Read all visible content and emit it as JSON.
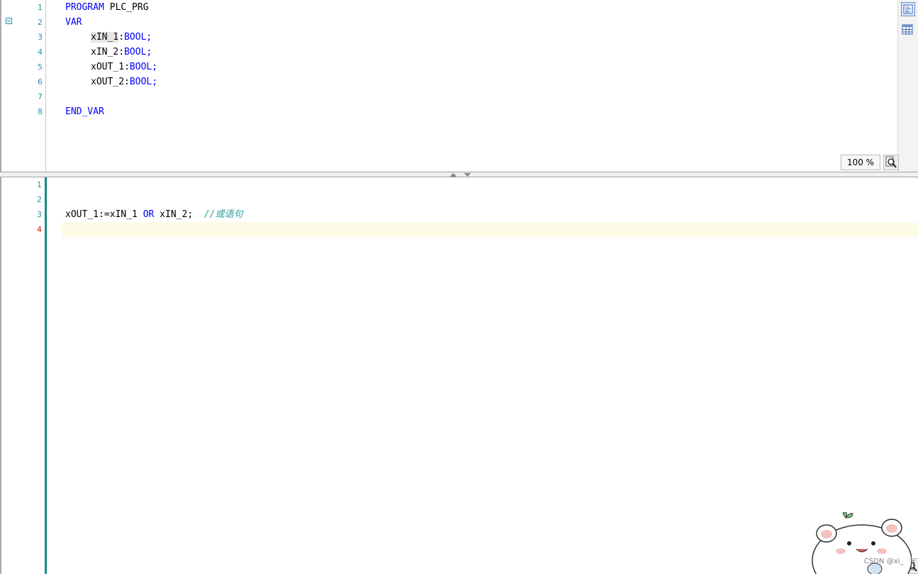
{
  "declaration": {
    "line_numbers": [
      "1",
      "2",
      "3",
      "4",
      "5",
      "6",
      "7",
      "8"
    ],
    "lines": {
      "l1_kw": "PROGRAM",
      "l1_name": " PLC_PRG",
      "l2_kw": "VAR",
      "l3_var": "xIN_1",
      "l3_sep": ":",
      "l3_type": "BOOL;",
      "l4_var": "xIN_2",
      "l4_sep": ":",
      "l4_type": "BOOL;",
      "l5_var": "xOUT_1",
      "l5_sep": ":",
      "l5_type": "BOOL;",
      "l6_var": "xOUT_2",
      "l6_sep": ":",
      "l6_type": "BOOL;",
      "l8_kw": "END_VAR"
    },
    "zoom": "100 %"
  },
  "implementation": {
    "line_numbers": [
      "1",
      "2",
      "3",
      "4"
    ],
    "current_line": "4",
    "code": {
      "assign": "xOUT_1:=xIN_1 ",
      "op": "OR",
      "rest": " xIN_2;  ",
      "comment": "//或语句"
    }
  },
  "watermark": "CSDN @xi_",
  "icons": {
    "fold": "collapse-icon",
    "text_view": "text-view-icon",
    "table_view": "table-view-icon",
    "zoom": "zoom-icon"
  }
}
